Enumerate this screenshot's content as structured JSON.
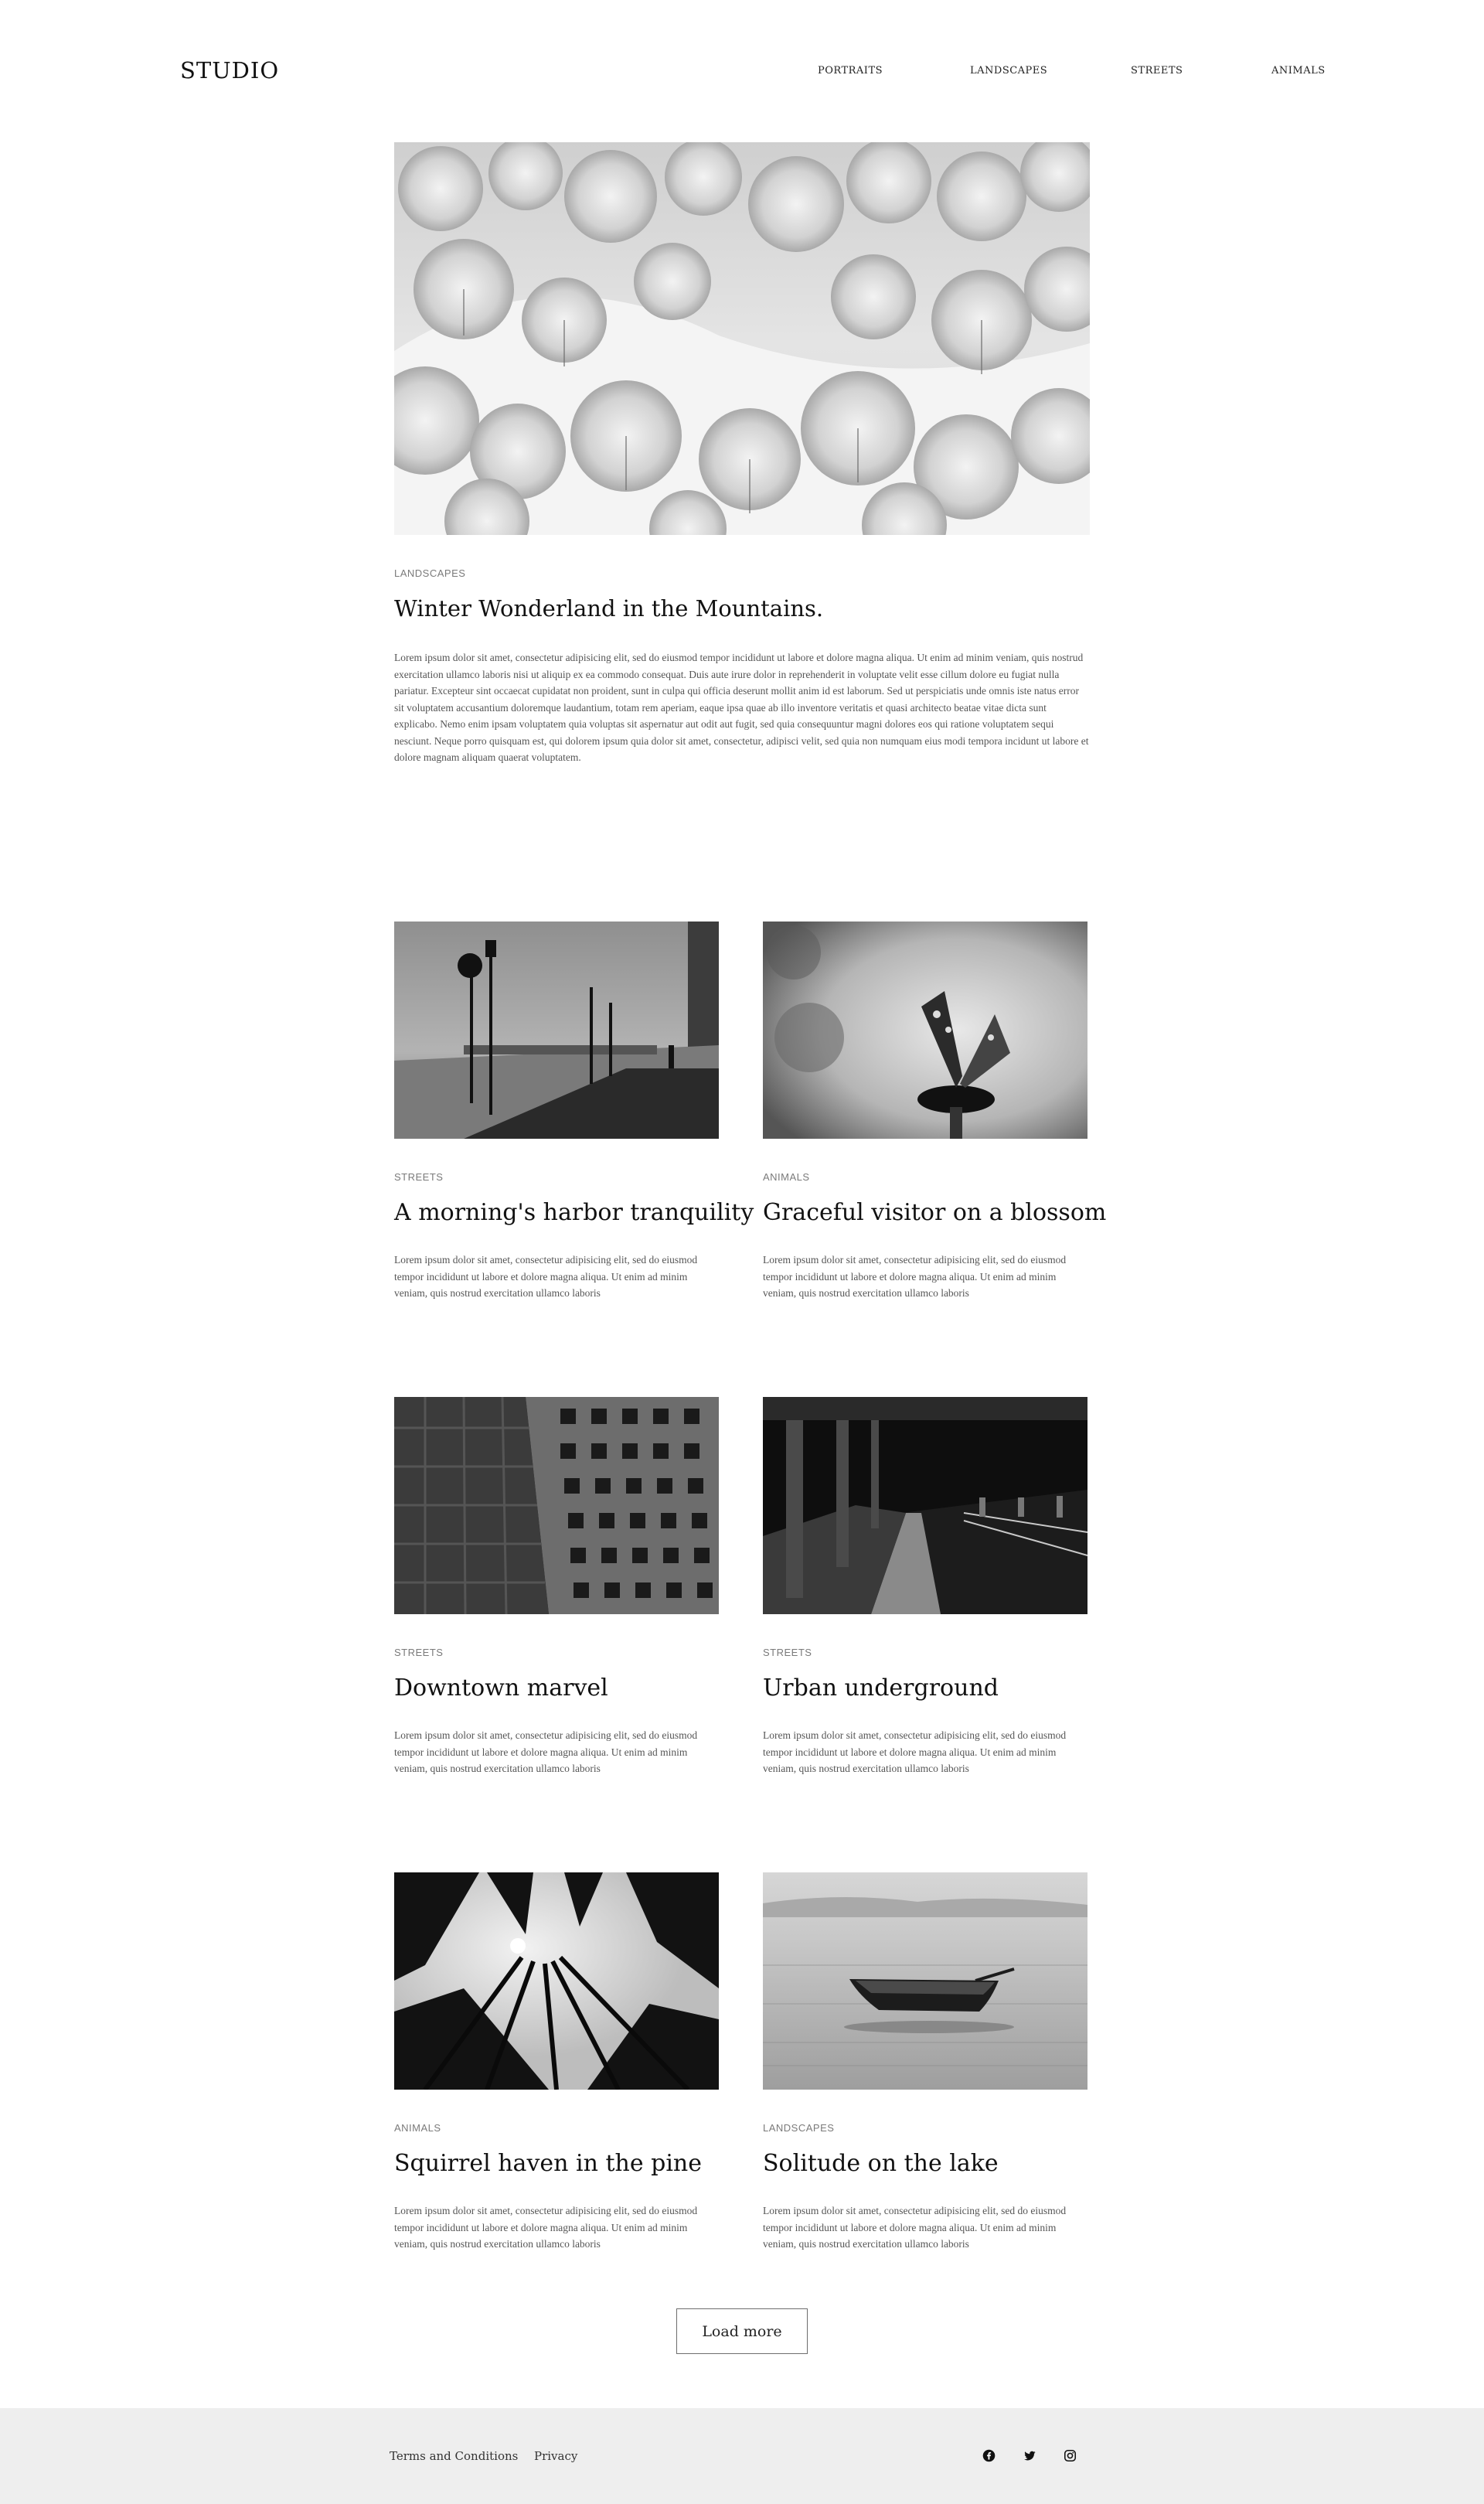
{
  "header": {
    "logo": "STUDIO",
    "nav": [
      "PORTRAITS",
      "LANDSCAPES",
      "STREETS",
      "ANIMALS"
    ]
  },
  "feature": {
    "category": "LANDSCAPES",
    "title": "Winter Wonderland in the Mountains.",
    "excerpt": "Lorem ipsum dolor sit amet, consectetur adipisicing elit, sed do eiusmod tempor incididunt ut labore et dolore magna aliqua. Ut enim ad minim veniam, quis nostrud exercitation ullamco laboris nisi ut aliquip ex ea commodo consequat. Duis aute irure dolor in reprehenderit in voluptate velit esse cillum dolore eu fugiat nulla pariatur. Excepteur sint occaecat cupidatat non proident, sunt in culpa qui officia deserunt mollit anim id est laborum. Sed ut perspiciatis unde omnis iste natus error sit voluptatem accusantium doloremque laudantium, totam rem aperiam, eaque ipsa quae ab illo inventore veritatis et quasi architecto beatae vitae dicta sunt explicabo. Nemo enim ipsam voluptatem quia voluptas sit aspernatur aut odit aut fugit, sed quia consequuntur magni dolores eos qui ratione voluptatem sequi nesciunt. Neque porro quisquam est, qui dolorem ipsum quia dolor sit amet, consectetur, adipisci velit, sed quia non numquam eius modi tempora incidunt ut labore et dolore magnam aliquam quaerat voluptatem."
  },
  "posts": [
    {
      "category": "STREETS",
      "title": "A morning's harbor tranquility",
      "excerpt": "Lorem ipsum dolor sit amet, consectetur adipisicing elit, sed do eiusmod tempor incididunt ut labore et dolore magna aliqua. Ut enim ad minim veniam, quis nostrud exercitation ullamco laboris"
    },
    {
      "category": "ANIMALS",
      "title": "Graceful visitor on a blossom",
      "excerpt": "Lorem ipsum dolor sit amet, consectetur adipisicing elit, sed do eiusmod tempor incididunt ut labore et dolore magna aliqua. Ut enim ad minim veniam, quis nostrud exercitation ullamco laboris"
    },
    {
      "category": "STREETS",
      "title": "Downtown marvel",
      "excerpt": "Lorem ipsum dolor sit amet, consectetur adipisicing elit, sed do eiusmod tempor incididunt ut labore et dolore magna aliqua. Ut enim ad minim veniam, quis nostrud exercitation ullamco laboris"
    },
    {
      "category": "STREETS",
      "title": "Urban underground",
      "excerpt": "Lorem ipsum dolor sit amet, consectetur adipisicing elit, sed do eiusmod tempor incididunt ut labore et dolore magna aliqua. Ut enim ad minim veniam, quis nostrud exercitation ullamco laboris"
    },
    {
      "category": "ANIMALS",
      "title": "Squirrel haven in the pine",
      "excerpt": "Lorem ipsum dolor sit amet, consectetur adipisicing elit, sed do eiusmod tempor incididunt ut labore et dolore magna aliqua. Ut enim ad minim veniam, quis nostrud exercitation ullamco laboris"
    },
    {
      "category": "LANDSCAPES",
      "title": "Solitude on the lake",
      "excerpt": "Lorem ipsum dolor sit amet, consectetur adipisicing elit, sed do eiusmod tempor incididunt ut labore et dolore magna aliqua. Ut enim ad minim veniam, quis nostrud exercitation ullamco laboris"
    }
  ],
  "load_more_label": "Load more",
  "footer": {
    "links": [
      "Terms and Conditions",
      "Privacy"
    ],
    "social_icons": [
      "facebook-icon",
      "twitter-icon",
      "instagram-icon"
    ]
  }
}
